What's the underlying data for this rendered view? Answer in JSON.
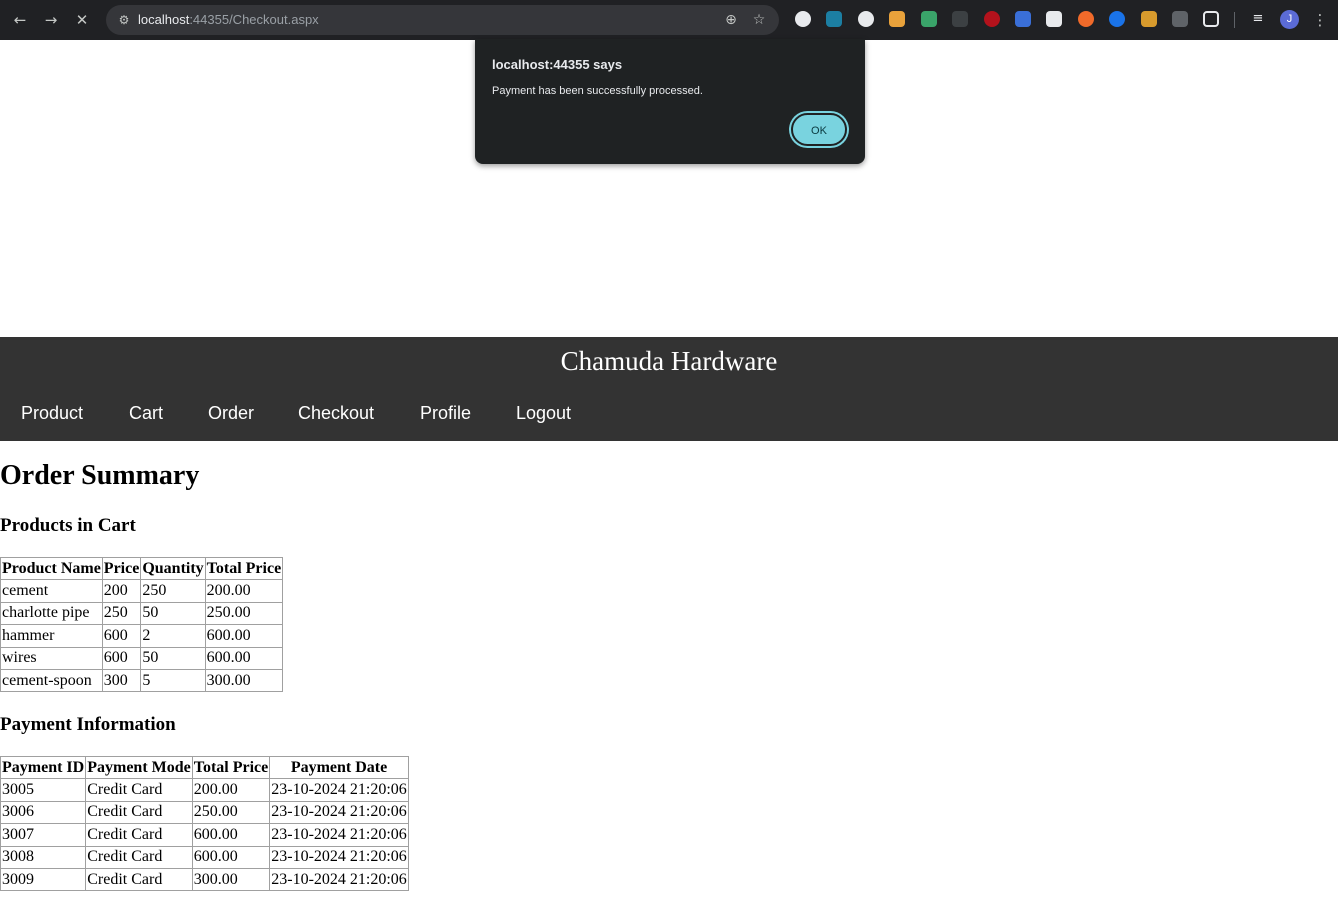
{
  "browser": {
    "url_host": "localhost",
    "url_rest": ":44355/Checkout.aspx",
    "back_icon": "←",
    "forward_icon": "→",
    "stop_icon": "✕",
    "site_info_icon": "⚙",
    "zoom_icon": "⊕",
    "bookmark_icon": "☆",
    "avatar_letter": "J",
    "menu_icon": "⋮"
  },
  "dialog": {
    "title": "localhost:44355 says",
    "message": "Payment has been successfully processed.",
    "ok_label": "OK"
  },
  "site": {
    "title": "Chamuda Hardware",
    "nav": [
      "Product",
      "Cart",
      "Order",
      "Checkout",
      "Profile",
      "Logout"
    ]
  },
  "page": {
    "heading": "Order Summary",
    "cart_heading": "Products in Cart",
    "payment_heading": "Payment Information"
  },
  "cart_table": {
    "headers": [
      "Product Name",
      "Price",
      "Quantity",
      "Total Price"
    ],
    "rows": [
      [
        "cement",
        "200",
        "250",
        "200.00"
      ],
      [
        "charlotte pipe",
        "250",
        "50",
        "250.00"
      ],
      [
        "hammer",
        "600",
        "2",
        "600.00"
      ],
      [
        "wires",
        "600",
        "50",
        "600.00"
      ],
      [
        "cement-spoon",
        "300",
        "5",
        "300.00"
      ]
    ]
  },
  "payment_table": {
    "headers": [
      "Payment ID",
      "Payment Mode",
      "Total Price",
      "Payment Date"
    ],
    "rows": [
      [
        "3005",
        "Credit Card",
        "200.00",
        "23-10-2024 21:20:06"
      ],
      [
        "3006",
        "Credit Card",
        "250.00",
        "23-10-2024 21:20:06"
      ],
      [
        "3007",
        "Credit Card",
        "600.00",
        "23-10-2024 21:20:06"
      ],
      [
        "3008",
        "Credit Card",
        "600.00",
        "23-10-2024 21:20:06"
      ],
      [
        "3009",
        "Credit Card",
        "300.00",
        "23-10-2024 21:20:06"
      ]
    ]
  },
  "colors": {
    "chrome_bg": "#202124",
    "header_bg": "#333333",
    "dialog_bg": "#1f2223",
    "ok_button": "#79d3df"
  }
}
